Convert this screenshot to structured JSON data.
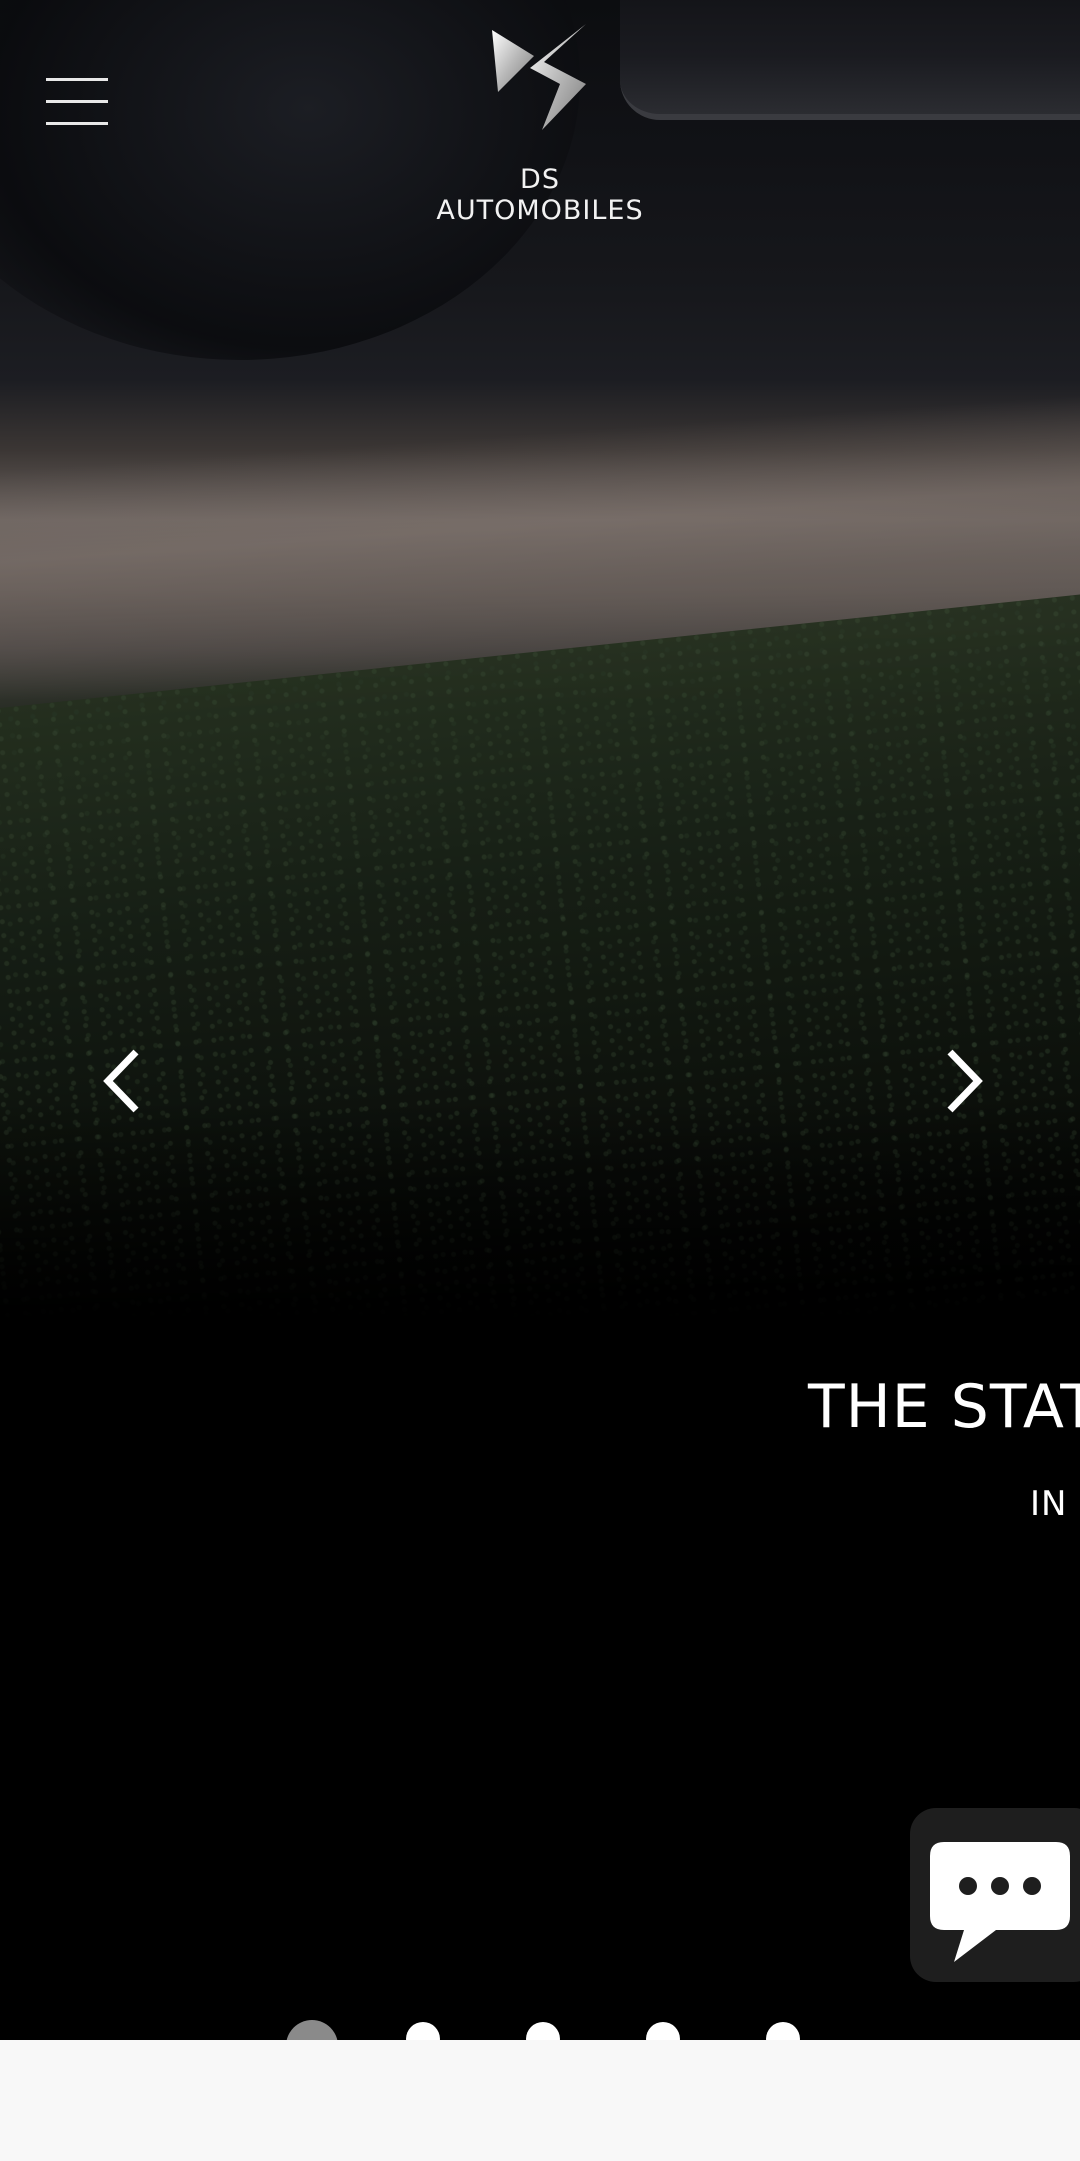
{
  "header": {
    "brand_name": "DS AUTOMOBILES",
    "menu_icon": "hamburger-menu-icon",
    "logo_icon": "ds-logo-icon"
  },
  "carousel": {
    "prev_icon": "chevron-left-icon",
    "next_icon": "chevron-right-icon",
    "slide_title": "THE STATU",
    "slide_subtitle": "IN",
    "slide_count": 5,
    "active_index": 0
  },
  "chat": {
    "icon": "chat-bubble-icon"
  },
  "colors": {
    "background": "#000000",
    "text": "#ffffff",
    "chat_button_bg": "#1e1e1e",
    "active_dot": "#8a8a8a",
    "inactive_dot": "#ffffff",
    "bottom_bar": "#f8f8f8"
  }
}
